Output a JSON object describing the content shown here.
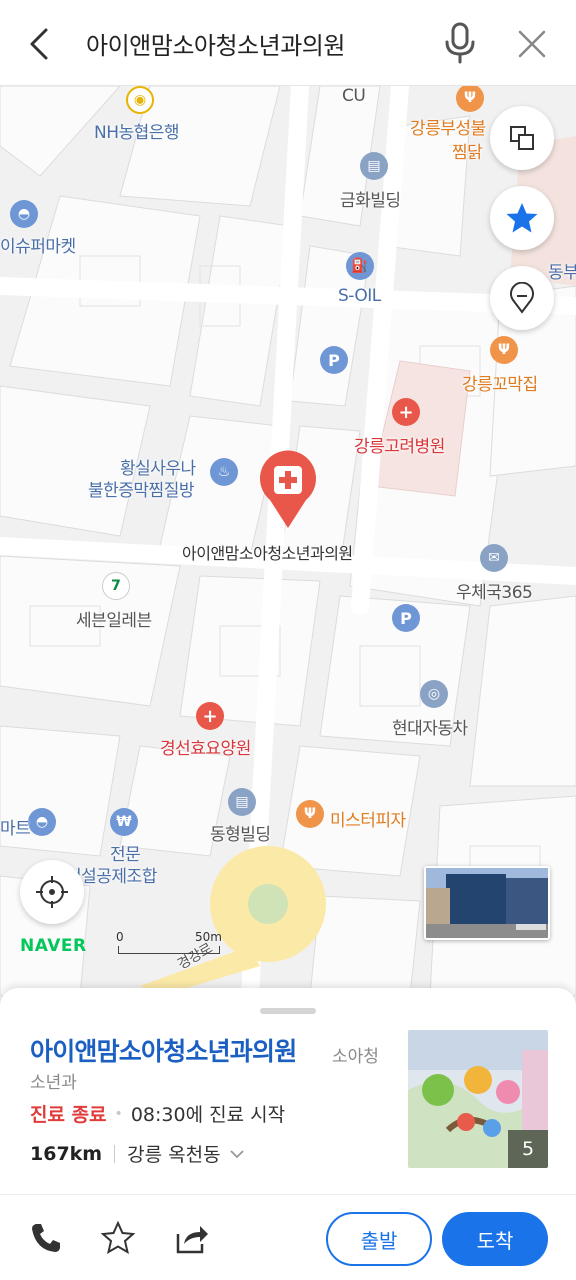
{
  "search": {
    "query": "아이앤맘소아청소년과의원"
  },
  "map": {
    "pois": {
      "cu": "CU",
      "nh": "NH농협은행",
      "gangneung_restaurant_line1": "강릉부성불",
      "gangneung_restaurant_line2": "찜닭",
      "geumhwa": "금화빌딩",
      "supermarket": "이슈퍼마켓",
      "soil": "S-OIL",
      "dongbu": "동부",
      "kkomakjip": "강릉꼬막집",
      "gangneung_hospital": "강릉고려병원",
      "sauna_line1": "황실사우나",
      "sauna_line2": "불한증막찜질방",
      "target_clinic": "아이앤맘소아청소년과의원",
      "post": "우체국365",
      "seven_eleven": "세븐일레븐",
      "hyundai": "현대자동차",
      "gyeongseon": "경선효요양원",
      "mister_pizza": "미스터피자",
      "donghyung": "동형빌딩",
      "mart": "마트",
      "construction_line1": "전문",
      "construction_line2": "건설공제조합",
      "road": "경강로"
    },
    "brand": "NAVER",
    "scale": {
      "zero": "0",
      "fifty": "50m"
    },
    "colors": {
      "hospital": "#e8574a",
      "poi_blue": "#6f97d6",
      "food": "#f0944a",
      "parking": "#6f97d6"
    }
  },
  "place": {
    "name": "아이앤맘소아청소년과의원",
    "category_part1": "소아청",
    "category_part2": "소년과",
    "status": "진료 종료",
    "hours": "08:30에 진료 시작",
    "distance": "167km",
    "address": "강릉 옥천동",
    "photo_count": "5"
  },
  "actions": {
    "depart": "출발",
    "arrive": "도착"
  }
}
